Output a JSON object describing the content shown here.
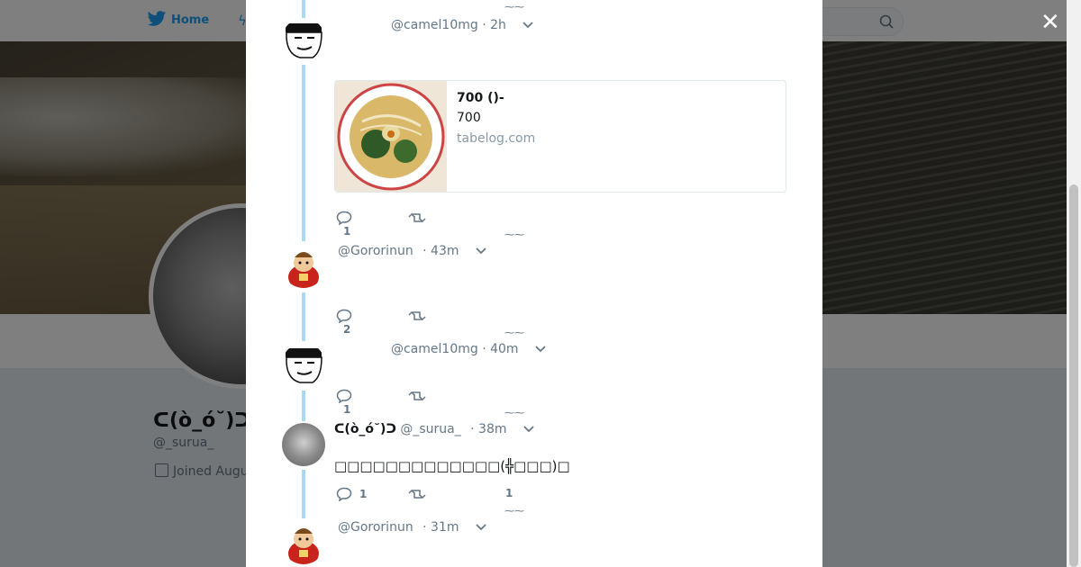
{
  "topnav": {
    "home_label": "Home"
  },
  "profile": {
    "name": "ᑕ(ò_ó˘)ᑐ",
    "handle": "@_surua_",
    "joined": "Joined Augu"
  },
  "modal": {
    "close_symbol": "✕",
    "tweets": [
      {
        "name": "",
        "handle": "@camel10mg",
        "time": "· 2h",
        "card": {
          "title": "700  ()-",
          "description": "700",
          "domain": "tabelog.com"
        },
        "replies": "1",
        "retweets": ""
      },
      {
        "name": "",
        "handle": "@Gororinun",
        "time": "· 43m",
        "replies": "2",
        "retweets": ""
      },
      {
        "name": "",
        "handle": "@camel10mg",
        "time": "· 40m",
        "replies": "1",
        "retweets": ""
      },
      {
        "name": "ᑕ(ò_ó˘)ᑐ",
        "handle": "@_surua_",
        "time": "· 38m",
        "text": "□□□□□□□□□□□□□(╬□□□)□",
        "replies": "1",
        "retweets": "",
        "likes": "1"
      },
      {
        "name": "",
        "handle": "@Gororinun",
        "time": "· 31m"
      }
    ]
  },
  "icons": [
    "twitter-bird-icon",
    "notifications-icon",
    "search-icon",
    "close-icon",
    "reply-icon",
    "retweet-icon",
    "chevron-down-icon",
    "calendar-icon"
  ],
  "colors": {
    "accent": "#1da1f2",
    "thread": "#a8daf4",
    "muted": "#657786"
  }
}
